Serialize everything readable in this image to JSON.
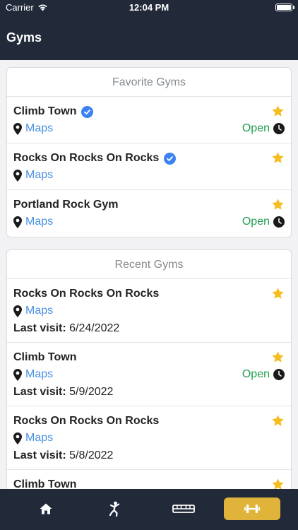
{
  "status_bar": {
    "carrier": "Carrier",
    "time": "12:04 PM"
  },
  "header": {
    "title": "Gyms"
  },
  "favorites": {
    "title": "Favorite Gyms",
    "items": [
      {
        "name": "Climb Town",
        "verified": true,
        "maps_label": "Maps",
        "open_label": "Open",
        "favorited": true
      },
      {
        "name": "Rocks On Rocks On Rocks",
        "verified": true,
        "maps_label": "Maps",
        "open_label": "",
        "favorited": true
      },
      {
        "name": "Portland Rock Gym",
        "verified": false,
        "maps_label": "Maps",
        "open_label": "Open",
        "favorited": true
      }
    ]
  },
  "recent": {
    "title": "Recent Gyms",
    "last_visit_label": "Last visit:",
    "items": [
      {
        "name": "Rocks On Rocks On Rocks",
        "maps_label": "Maps",
        "open_label": "",
        "last_visit": "6/24/2022",
        "favorited": true
      },
      {
        "name": "Climb Town",
        "maps_label": "Maps",
        "open_label": "Open",
        "last_visit": "5/9/2022",
        "favorited": true
      },
      {
        "name": "Rocks On Rocks On Rocks",
        "maps_label": "Maps",
        "open_label": "",
        "last_visit": "5/8/2022",
        "favorited": true
      },
      {
        "name": "Climb Town",
        "maps_label": "",
        "open_label": "",
        "last_visit": "",
        "favorited": true
      }
    ]
  },
  "tab_bar": {
    "tabs": [
      {
        "icon": "home-icon",
        "active": false
      },
      {
        "icon": "climber-icon",
        "active": false
      },
      {
        "icon": "hangboard-icon",
        "active": false
      },
      {
        "icon": "dumbbell-icon",
        "active": true
      }
    ]
  },
  "colors": {
    "header_bg": "#222a3a",
    "link_blue": "#4a90e2",
    "open_green": "#1f9d4f",
    "star_gold": "#f5bd1f",
    "verified_blue": "#3d82f2",
    "active_tab": "#e0b43a"
  }
}
